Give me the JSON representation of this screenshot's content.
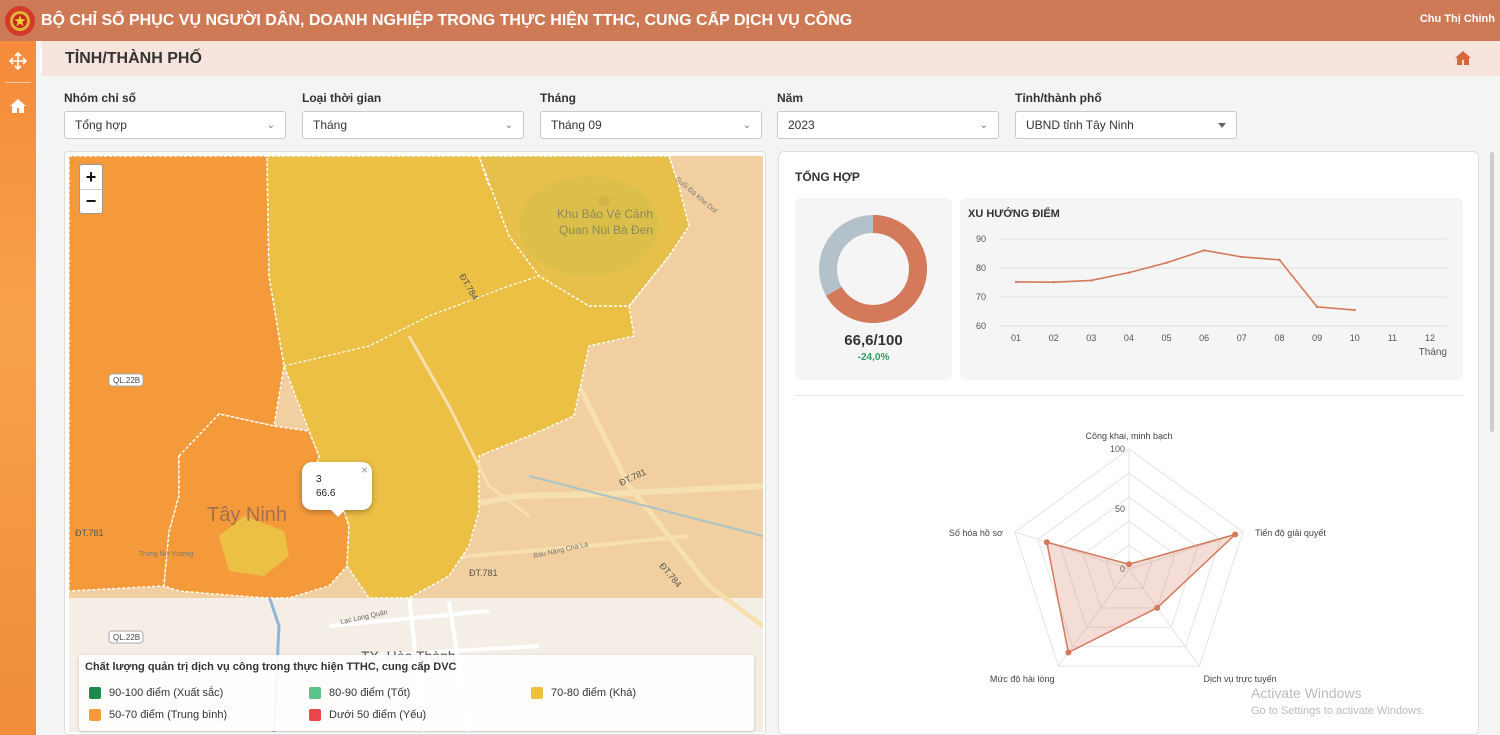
{
  "header": {
    "title": "BỘ CHỈ SỐ PHỤC VỤ NGƯỜI DÂN, DOANH NGHIỆP TRONG THỰC HIỆN TTHC, CUNG CẤP DỊCH VỤ CÔNG",
    "user": "Chu Thị Chinh",
    "bg_color": "#cf7a57"
  },
  "page": {
    "title": "TỈNH/THÀNH PHỐ"
  },
  "filters": [
    {
      "label": "Nhóm chỉ số",
      "value": "Tổng hợp"
    },
    {
      "label": "Loại thời gian",
      "value": "Tháng"
    },
    {
      "label": "Tháng",
      "value": "Tháng 09"
    },
    {
      "label": "Năm",
      "value": "2023"
    },
    {
      "label": "Tỉnh/thành phố",
      "value": "UBND tỉnh Tây Ninh"
    }
  ],
  "map": {
    "zoom_in": "+",
    "zoom_out": "−",
    "popup": {
      "line1": "3",
      "line2": "66.6",
      "close": "×"
    },
    "labels": {
      "park": "Khu Bảo Vệ Cảnh",
      "park2": "Quan Núi Bà Đen",
      "city": "Tây Ninh",
      "town": "TX. Hòa Thành",
      "ql22b_a": "QL.22B",
      "ql22b_b": "QL.22B",
      "dt781": "ĐT.781",
      "dt781b": "ĐT.781",
      "dt781c": "ĐT.781",
      "dt784": "ĐT.784",
      "dt784b": "ĐT.784",
      "road1": "Bàu Năng Chà Là",
      "road2": "Lạc Long Quân",
      "road3": "Trưng Nữ Vương",
      "road4": "Suối Đá Khe Dol"
    },
    "legend": {
      "title": "Chất lượng quản trị dịch vụ công trong thực hiện TTHC, cung cấp DVC",
      "items": [
        {
          "label": "90-100 điểm (Xuất sắc)",
          "color": "#1e8a4e"
        },
        {
          "label": "80-90 điểm (Tốt)",
          "color": "#5cc48a"
        },
        {
          "label": "70-80 điểm (Khá)",
          "color": "#f0c23a"
        },
        {
          "label": "50-70 điểm (Trung bình)",
          "color": "#f59a3a"
        },
        {
          "label": "Dưới 50 điểm (Yếu)",
          "color": "#e8464a"
        }
      ]
    }
  },
  "summary": {
    "title": "TỔNG HỢP",
    "score": "66,6/100",
    "delta": "-24,0%",
    "score_fraction": 0.666,
    "colors": {
      "main": "#d4795a",
      "rest": "#b3c2ca"
    }
  },
  "chart_data": [
    {
      "type": "line",
      "title": "XU HƯỚNG ĐIỂM",
      "xlabel": "Tháng",
      "ylabel": "",
      "ylim": [
        60,
        90
      ],
      "yticks": [
        60,
        70,
        80,
        90
      ],
      "categories": [
        "01",
        "02",
        "03",
        "04",
        "05",
        "06",
        "07",
        "08",
        "09",
        "10",
        "11",
        "12"
      ],
      "series": [
        {
          "values": [
            75.2,
            75.1,
            75.7,
            78.4,
            81.8,
            86.1,
            83.8,
            82.8,
            66.6,
            65.5,
            null,
            null
          ]
        }
      ],
      "grid": true
    },
    {
      "type": "radar",
      "axes": [
        "Công khai, minh bạch",
        "Tiến độ giải quyết",
        "Dịch vụ trực tuyến",
        "Mức độ hài lòng",
        "Số hóa hồ sơ"
      ],
      "rlim": [
        0,
        100
      ],
      "rticks": [
        "0",
        "50",
        "100"
      ],
      "series": [
        {
          "values": [
            4,
            93,
            40,
            86,
            72
          ]
        }
      ]
    }
  ],
  "watermark": {
    "line1": "Activate Windows",
    "line2": "Go to Settings to activate Windows."
  }
}
